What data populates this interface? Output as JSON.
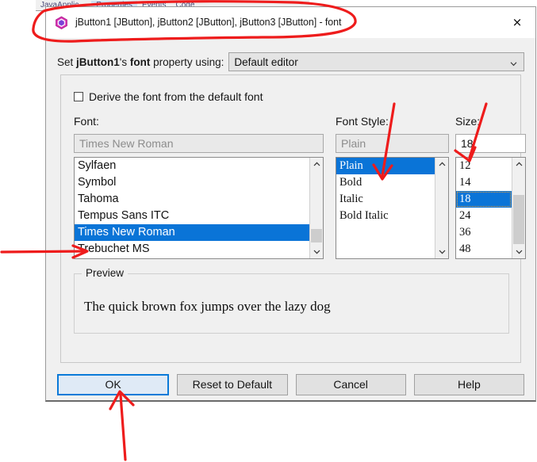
{
  "background": {
    "tabs": [
      {
        "label": "JavaApplic…",
        "active": false
      },
      {
        "label": "Properties",
        "active": true
      },
      {
        "label": "Events",
        "active": false
      },
      {
        "label": "Code",
        "active": false
      }
    ]
  },
  "dialog": {
    "icon": "netbeans-cube-icon",
    "title": "jButton1 [JButton], jButton2 [JButton], jButton3 [JButton] - font",
    "close_label": "×",
    "editor_row": {
      "prefix": "Set ",
      "component": "jButton1",
      "middle": "'s ",
      "property": "font",
      "suffix": " property using:",
      "combo_value": "Default editor",
      "combo_icon": "chevron-down-icon"
    },
    "derive": {
      "label": "Derive the font from the default font",
      "checked": false
    },
    "font": {
      "label": "Font:",
      "field_value": "Times New Roman",
      "items": [
        "Sylfaen",
        "Symbol",
        "Tahoma",
        "Tempus Sans ITC",
        "Times New Roman",
        "Trebuchet MS"
      ],
      "selected": "Times New Roman"
    },
    "style": {
      "label": "Font Style:",
      "field_value": "Plain",
      "items": [
        "Plain",
        "Bold",
        "Italic",
        "Bold Italic"
      ],
      "selected": "Plain"
    },
    "size": {
      "label": "Size:",
      "field_value": "18",
      "items": [
        "12",
        "14",
        "18",
        "24",
        "36",
        "48"
      ],
      "selected": "18"
    },
    "preview": {
      "legend": "Preview",
      "text": "The quick brown fox jumps over the lazy dog"
    },
    "buttons": {
      "ok": "OK",
      "reset": "Reset to Default",
      "cancel": "Cancel",
      "help": "Help"
    }
  },
  "colors": {
    "selection_blue": "#0a74d7",
    "default_button_border": "#0a7ad8",
    "annotation_red": "#ee1c1c",
    "dialog_face": "#f0f0f0"
  }
}
